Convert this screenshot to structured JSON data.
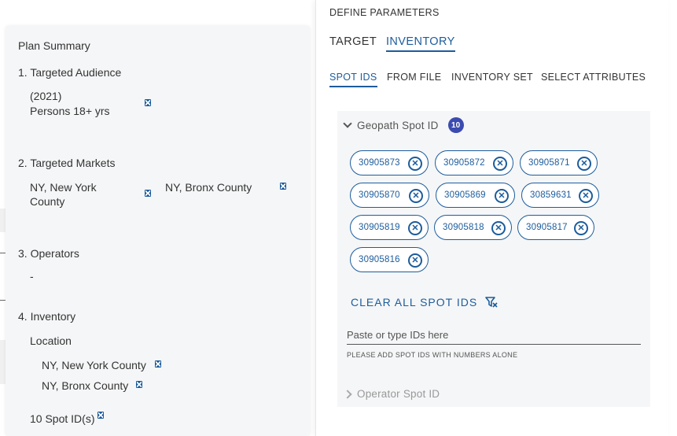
{
  "plan_summary": {
    "title": "Plan Summary",
    "audience": {
      "heading": "1. Targeted Audience",
      "year": "(2021)",
      "value": "Persons 18+ yrs"
    },
    "markets": {
      "heading": "2. Targeted Markets",
      "items": [
        {
          "line1": "NY, New York",
          "line2": "County"
        },
        {
          "line1": "NY, Bronx County"
        }
      ]
    },
    "operators": {
      "heading": "3. Operators",
      "value": "-"
    },
    "inventory": {
      "heading": "4. Inventory",
      "location_label": "Location",
      "locations": [
        "NY, New York County",
        "NY, Bronx County"
      ],
      "spot_ids_summary": "10 Spot ID(s)"
    }
  },
  "define_parameters": {
    "header": "DEFINE PARAMETERS",
    "tabs": [
      {
        "label": "TARGET",
        "active": false
      },
      {
        "label": "INVENTORY",
        "active": true
      }
    ],
    "subtabs": [
      {
        "label": "SPOT IDS",
        "active": true
      },
      {
        "label": "FROM FILE",
        "active": false
      },
      {
        "label": "INVENTORY SET",
        "active": false
      },
      {
        "label": "SELECT ATTRIBUTES",
        "active": false
      }
    ],
    "geopath_section": {
      "label": "Geopath Spot ID",
      "count": "10",
      "expanded": true,
      "spot_ids": [
        "30905873",
        "30905872",
        "30905871",
        "30905870",
        "30905869",
        "30859631",
        "30905819",
        "30905818",
        "30905817",
        "30905816"
      ]
    },
    "clear_all_label": "CLEAR ALL SPOT IDS",
    "input_placeholder": "Paste or type IDs here",
    "hint": "PLEASE ADD SPOT IDS WITH NUMBERS ALONE",
    "operator_section": {
      "label": "Operator Spot ID",
      "expanded": false
    }
  },
  "colors": {
    "accent": "#1c5c9c",
    "badge": "#3b4bb0",
    "panel_bg": "#f5f6f7"
  },
  "icons": [
    "remove-icon",
    "chevron-down-icon",
    "chevron-right-icon",
    "chip-remove-icon",
    "clear-filter-icon"
  ]
}
